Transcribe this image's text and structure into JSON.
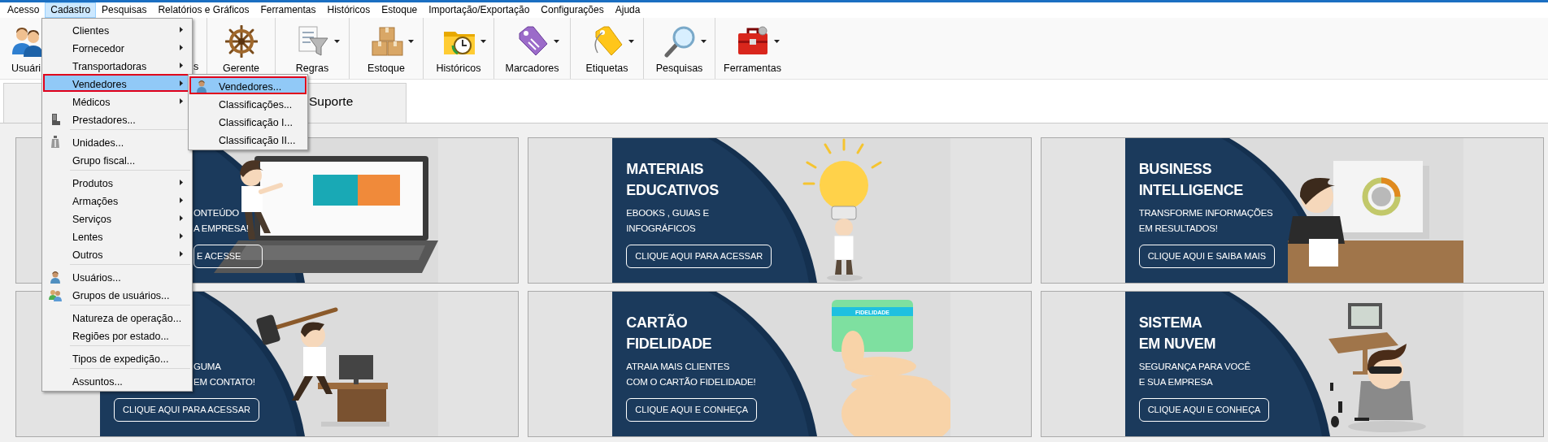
{
  "menu_bar": [
    {
      "label": "Acesso",
      "selected": false
    },
    {
      "label": "Cadastro",
      "selected": true
    },
    {
      "label": "Pesquisas",
      "selected": false
    },
    {
      "label": "Relatórios e Gráficos",
      "selected": false
    },
    {
      "label": "Ferramentas",
      "selected": false
    },
    {
      "label": "Históricos",
      "selected": false
    },
    {
      "label": "Estoque",
      "selected": false
    },
    {
      "label": "Importação/Exportação",
      "selected": false
    },
    {
      "label": "Configurações",
      "selected": false
    },
    {
      "label": "Ajuda",
      "selected": false
    }
  ],
  "toolbar": [
    {
      "label": "Usuári",
      "kind": "users"
    },
    {
      "label": "s",
      "kind": "fragment"
    },
    {
      "label": "Gerente",
      "kind": "wheel",
      "dropdown": false
    },
    {
      "label": "Regras",
      "kind": "funnel",
      "dropdown": true
    },
    {
      "label": "Estoque",
      "kind": "boxes",
      "dropdown": true
    },
    {
      "label": "Históricos",
      "kind": "history",
      "dropdown": true
    },
    {
      "label": "Marcadores",
      "kind": "marker",
      "dropdown": true
    },
    {
      "label": "Etiquetas",
      "kind": "label",
      "dropdown": true
    },
    {
      "label": "Pesquisas",
      "kind": "search",
      "dropdown": true
    },
    {
      "label": "Ferramentas",
      "kind": "tools",
      "dropdown": true
    }
  ],
  "tabs": [
    {
      "label": "Suporte"
    }
  ],
  "menu": {
    "groups": [
      [
        {
          "label": "Clientes",
          "kind": "plain",
          "submenu": true,
          "selected": false
        },
        {
          "label": "Fornecedor",
          "kind": "plain",
          "submenu": true,
          "selected": false
        },
        {
          "label": "Transportadoras",
          "kind": "plain",
          "submenu": true,
          "selected": false
        },
        {
          "label": "Vendedores",
          "kind": "plain",
          "submenu": true,
          "selected": true
        },
        {
          "label": "Médicos",
          "kind": "plain",
          "submenu": true,
          "selected": false
        },
        {
          "label": "Prestadores...",
          "kind": "providers",
          "submenu": false,
          "selected": false
        }
      ],
      [
        {
          "label": "Unidades...",
          "kind": "units",
          "submenu": false,
          "selected": false
        },
        {
          "label": "Grupo fiscal...",
          "kind": "plain",
          "submenu": false,
          "selected": false
        }
      ],
      [
        {
          "label": "Produtos",
          "kind": "plain",
          "submenu": true,
          "selected": false
        },
        {
          "label": "Armações",
          "kind": "plain",
          "submenu": true,
          "selected": false
        },
        {
          "label": "Serviços",
          "kind": "plain",
          "submenu": true,
          "selected": false
        },
        {
          "label": "Lentes",
          "kind": "plain",
          "submenu": true,
          "selected": false
        },
        {
          "label": "Outros",
          "kind": "plain",
          "submenu": true,
          "selected": false
        }
      ],
      [
        {
          "label": "Usuários...",
          "kind": "user",
          "submenu": false,
          "selected": false
        },
        {
          "label": "Grupos de usuários...",
          "kind": "group",
          "submenu": false,
          "selected": false
        }
      ],
      [
        {
          "label": "Natureza de operação...",
          "kind": "plain",
          "submenu": false,
          "selected": false
        },
        {
          "label": "Regiões por estado...",
          "kind": "plain",
          "submenu": false,
          "selected": false
        }
      ],
      [
        {
          "label": "Tipos de expedição...",
          "kind": "plain",
          "submenu": false,
          "selected": false
        }
      ],
      [
        {
          "label": "Assuntos...",
          "kind": "plain",
          "submenu": false,
          "selected": false
        }
      ]
    ]
  },
  "submenu": {
    "items": [
      {
        "label": "Vendedores...",
        "kind": "user",
        "selected": true
      },
      {
        "label": "Classificações...",
        "kind": "plain",
        "selected": false
      },
      {
        "label": "Classificação I...",
        "kind": "plain",
        "selected": false
      },
      {
        "label": "Classificação II...",
        "kind": "plain",
        "selected": false
      }
    ]
  },
  "banners": [
    {
      "kind": "laptop",
      "subtitle": [
        "ONTEÚDO",
        "A EMPRESA!"
      ],
      "button": "E ACESSE"
    },
    {
      "kind": "bulb",
      "title": [
        "MATERIAIS",
        "EDUCATIVOS"
      ],
      "subtitle": [
        "EBOOKS , GUIAS E",
        "INFOGRÁFICOS"
      ],
      "button": "CLIQUE AQUI PARA ACESSAR"
    },
    {
      "kind": "presentation",
      "title": [
        "BUSINESS",
        "INTELLIGENCE"
      ],
      "subtitle": [
        "TRANSFORME INFORMAÇÕES",
        "EM RESULTADOS!"
      ],
      "button": "CLIQUE AQUI E SAIBA MAIS"
    },
    {
      "kind": "hammer",
      "subtitle": [
        "GUMA",
        "EM CONTATO!"
      ],
      "button": "CLIQUE AQUI PARA ACESSAR"
    },
    {
      "kind": "card",
      "title": [
        "CARTÃO",
        "FIDELIDADE"
      ],
      "subtitle": [
        "ATRAIA MAIS CLIENTES",
        "COM O CARTÃO FIDELIDADE!"
      ],
      "button": "CLIQUE AQUI E CONHEÇA",
      "art_label": "FIDELIDADE"
    },
    {
      "kind": "thief",
      "title": [
        "SISTEMA",
        "EM NUVEM"
      ],
      "subtitle": [
        "SEGURANÇA PARA VOCÊ",
        "E SUA EMPRESA"
      ],
      "button": "CLIQUE AQUI E CONHEÇA"
    }
  ]
}
